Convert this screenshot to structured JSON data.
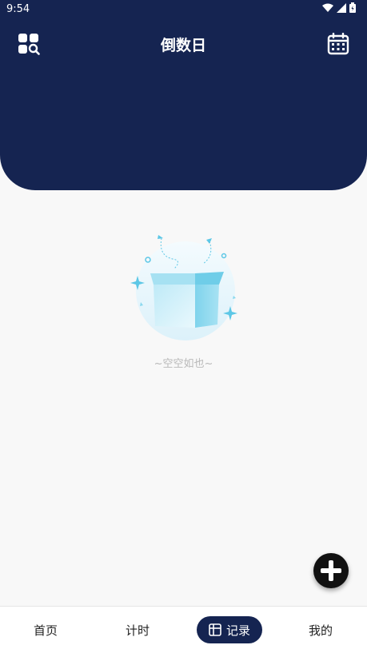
{
  "status_bar": {
    "time": "9:54"
  },
  "header": {
    "title": "倒数日",
    "left_icon": "grid-search-icon",
    "right_icon": "calendar-icon",
    "background_color": "#152451"
  },
  "empty_state": {
    "illustration": "empty-box-icon",
    "text": "~空空如也~"
  },
  "fab": {
    "icon": "plus-icon"
  },
  "tabs": [
    {
      "label": "首页",
      "active": false
    },
    {
      "label": "计时",
      "active": false
    },
    {
      "label": "记录",
      "active": true,
      "icon": "record-icon"
    },
    {
      "label": "我的",
      "active": false
    }
  ]
}
